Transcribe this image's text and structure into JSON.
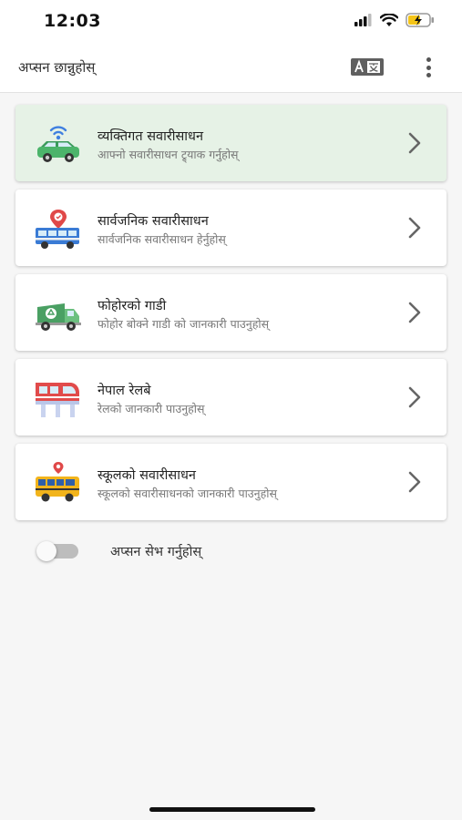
{
  "status_bar": {
    "time": "12:03",
    "icons": [
      "signal-icon",
      "wifi-icon",
      "battery-charging-icon"
    ]
  },
  "app_bar": {
    "title": "अप्सन छान्नुहोस्",
    "actions": [
      "translate-icon",
      "more-vertical-icon"
    ]
  },
  "options": [
    {
      "title": "व्यक्तिगत सवारीसाधन",
      "subtitle": "आफ्नो सवारीसाधन ट्र्याक गर्नुहोस्",
      "icon": "car-tracking-icon",
      "selected": true
    },
    {
      "title": "सार्वजनिक सवारीसाधन",
      "subtitle": "सार्वजनिक सवारीसाधन हेर्नुहोस्",
      "icon": "public-bus-icon",
      "selected": false
    },
    {
      "title": "फोहोरको गाडी",
      "subtitle": "फोहोर बोक्ने गाडी को जानकारी पाउनुहोस्",
      "icon": "garbage-truck-icon",
      "selected": false
    },
    {
      "title": "नेपाल रेलबे",
      "subtitle": "रेलको जानकारी पाउनुहोस्",
      "icon": "train-icon",
      "selected": false
    },
    {
      "title": "स्कूलको सवारीसाधन",
      "subtitle": "स्कूलको सवारीसाधनको जानकारी पाउनुहोस्",
      "icon": "school-bus-icon",
      "selected": false
    }
  ],
  "save_option": {
    "label": "अप्सन सेभ गर्नुहोस्",
    "enabled": false
  },
  "colors": {
    "selected_card": "#e6f2e6",
    "card": "#ffffff",
    "background": "#f6f6f6",
    "battery_charge": "#f5c518"
  }
}
